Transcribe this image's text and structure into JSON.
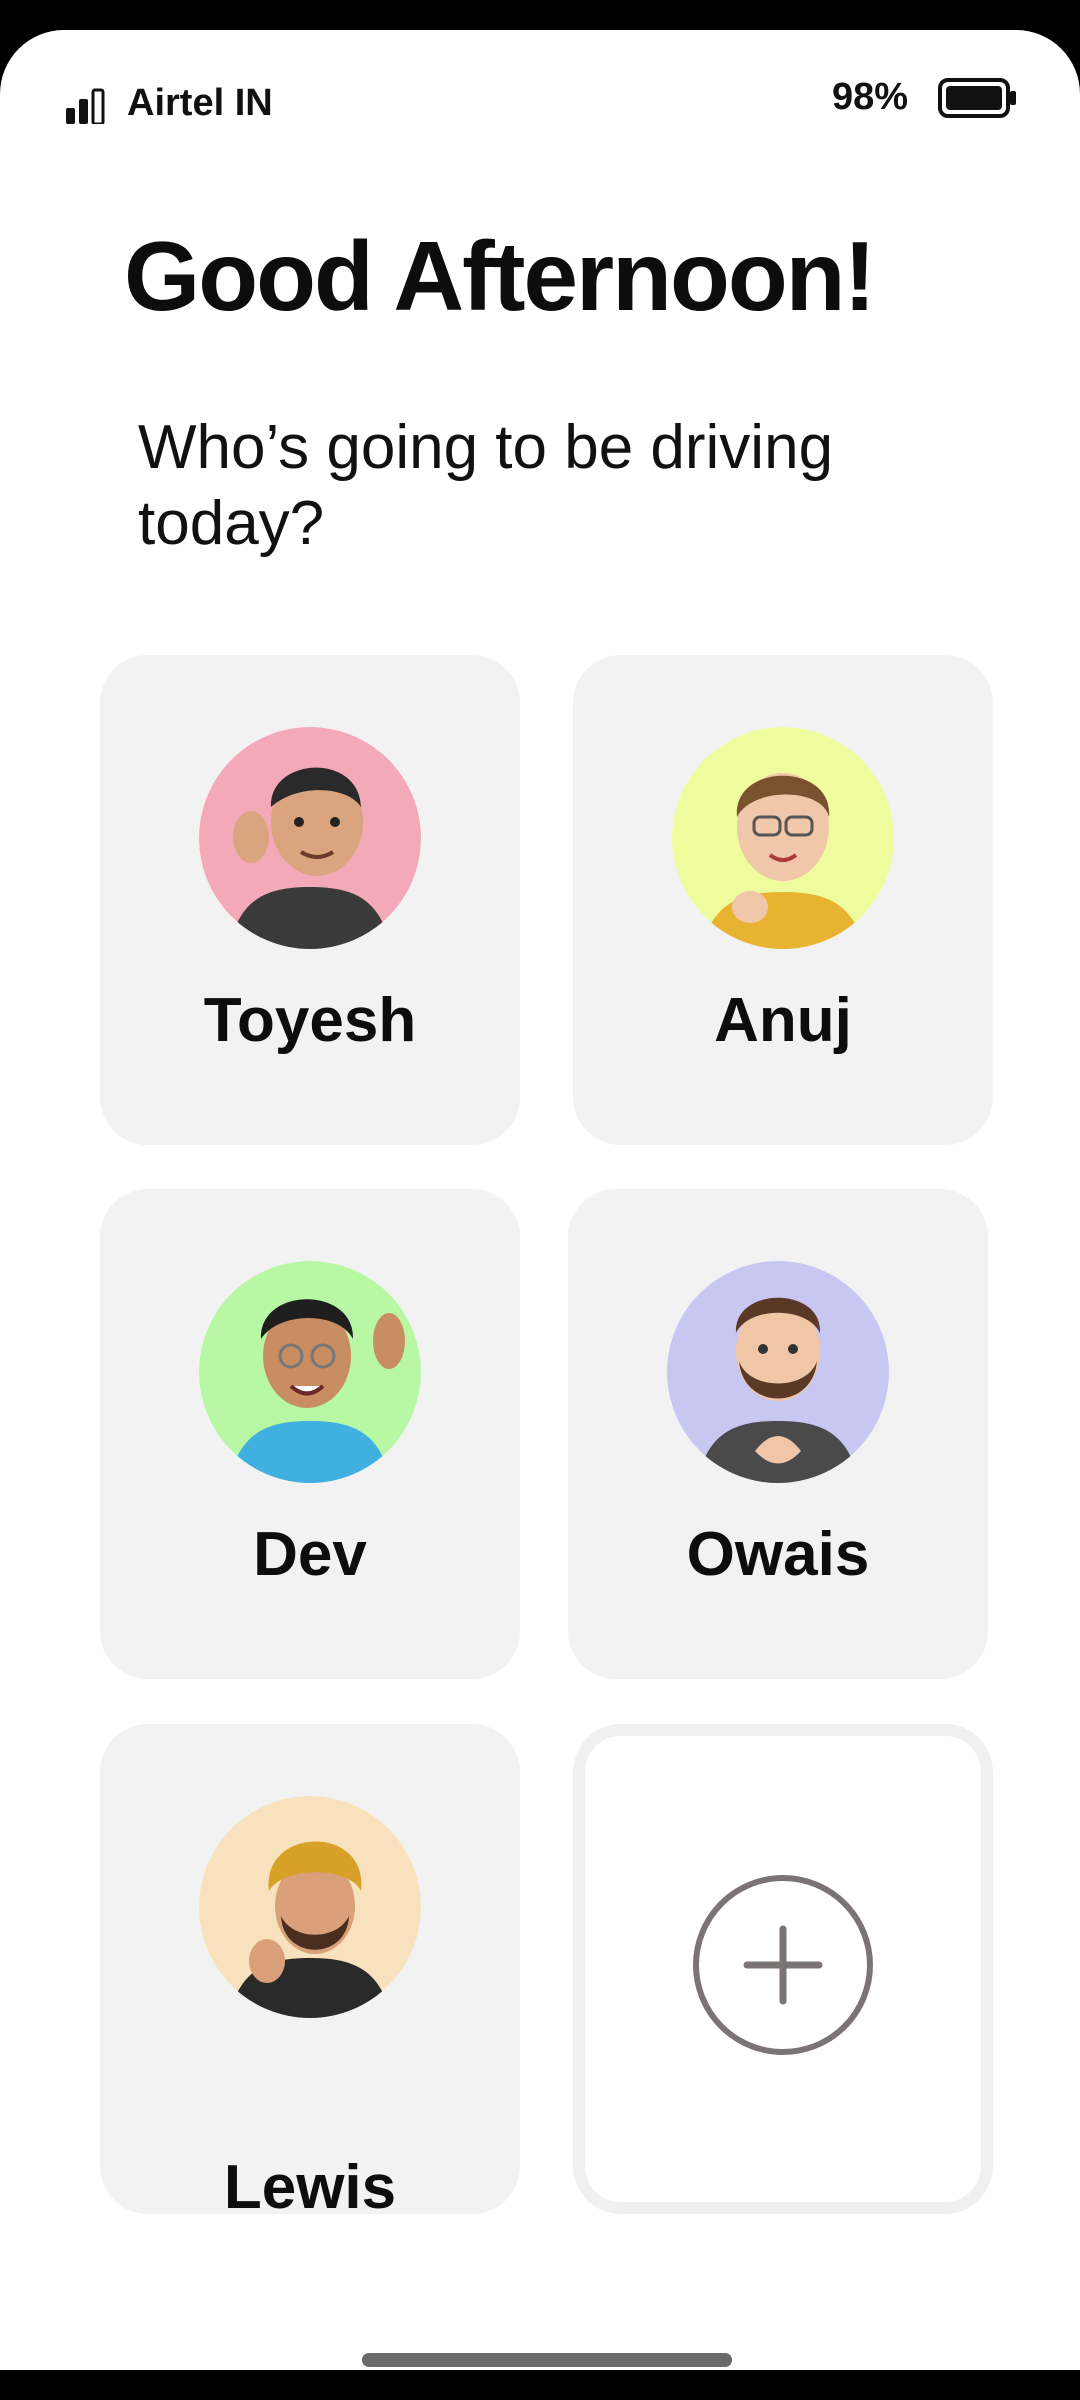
{
  "status_bar": {
    "carrier": "Airtel IN",
    "battery_percent": "98%",
    "icons": [
      "signal-icon",
      "battery-icon"
    ]
  },
  "header": {
    "greeting": "Good Afternoon!",
    "prompt": "Who’s going to be driving today?"
  },
  "profiles": [
    {
      "name": "Toyesh",
      "avatar_bg": "#f4a9b8",
      "icon": "memoji-avatar"
    },
    {
      "name": "Anuj",
      "avatar_bg": "#eefc9e",
      "icon": "memoji-avatar"
    },
    {
      "name": "Dev",
      "avatar_bg": "#b8f7a4",
      "icon": "memoji-avatar"
    },
    {
      "name": "Owais",
      "avatar_bg": "#c7c7f2",
      "icon": "memoji-avatar"
    },
    {
      "name": "Lewis",
      "avatar_bg": "#f8e2bd",
      "icon": "memoji-avatar"
    }
  ],
  "add_profile": {
    "icon": "plus-circle-icon",
    "color": "#7a7474"
  },
  "colors": {
    "card_bg": "#f2f2f2",
    "text": "#0d0d0d",
    "background": "#ffffff"
  }
}
